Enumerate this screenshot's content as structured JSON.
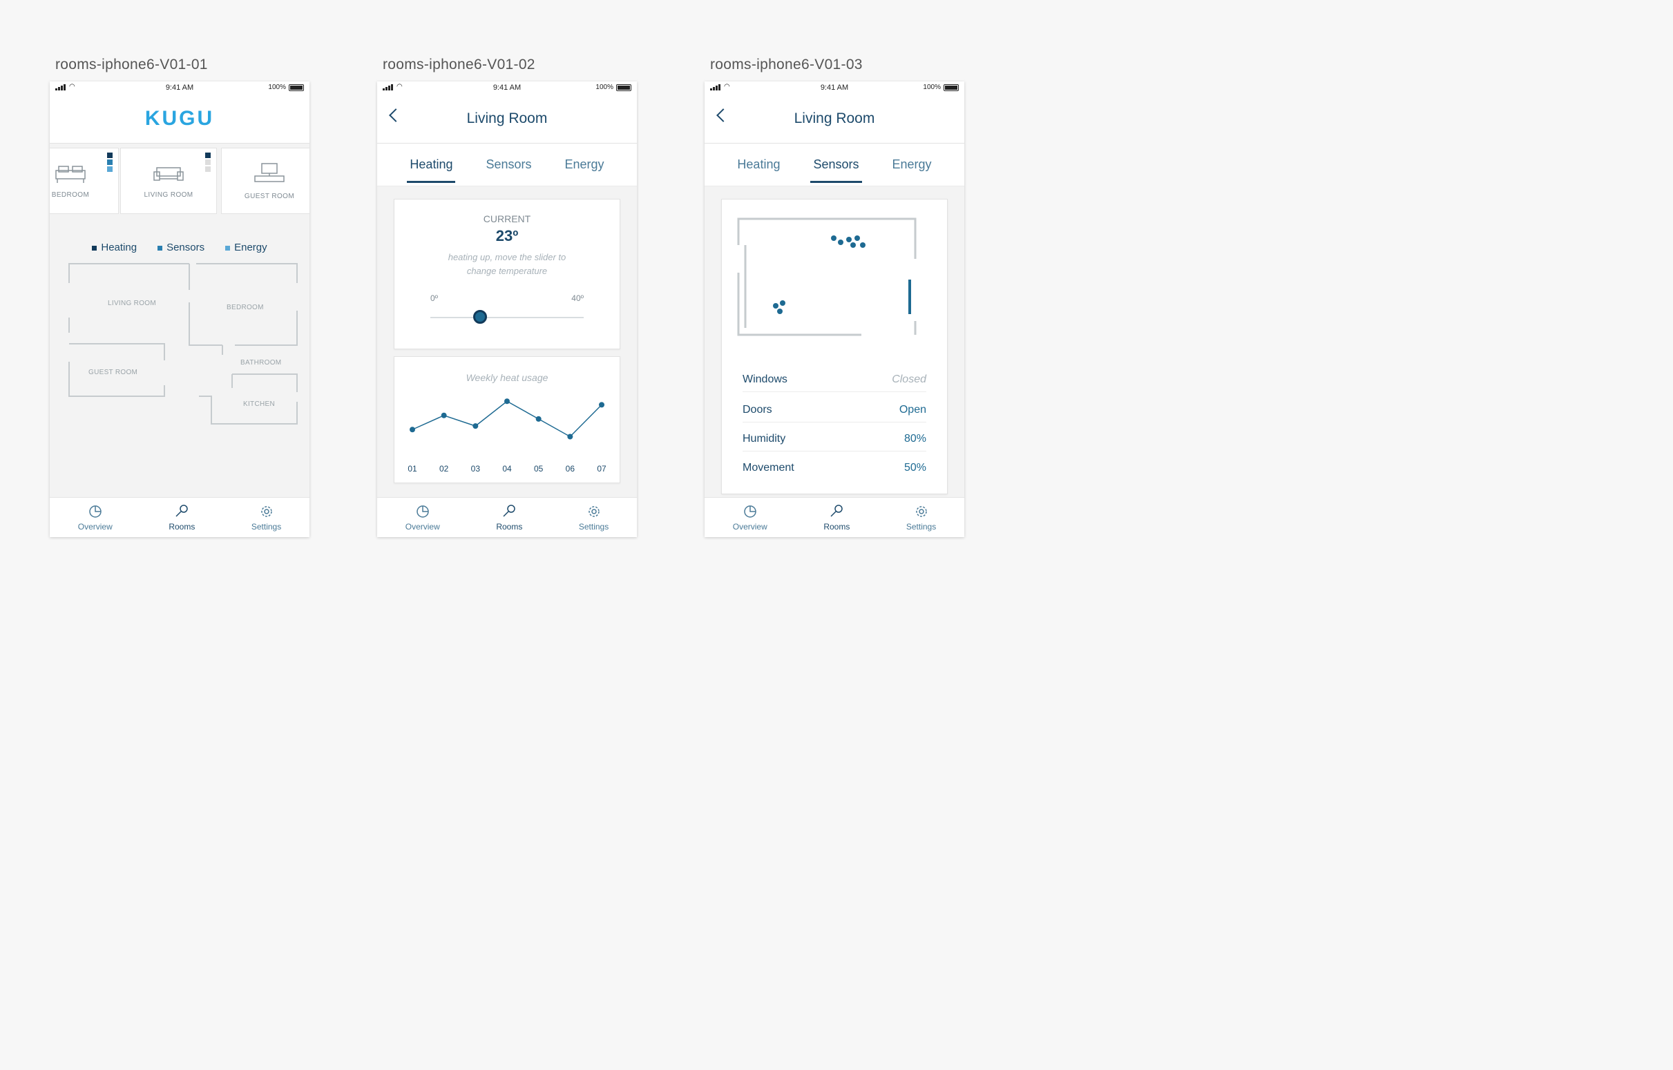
{
  "artboards": {
    "a1": "rooms-iphone6-V01-01",
    "a2": "rooms-iphone6-V01-02",
    "a3": "rooms-iphone6-V01-03"
  },
  "status": {
    "time": "9:41 AM",
    "battery": "100%"
  },
  "brand": "KUGU",
  "tabbar": {
    "overview": "Overview",
    "rooms": "Rooms",
    "settings": "Settings"
  },
  "screen1": {
    "rooms": [
      "BEDROOM",
      "LIVING ROOM",
      "GUEST ROOM"
    ],
    "legend": {
      "heating": "Heating",
      "sensors": "Sensors",
      "energy": "Energy"
    },
    "floorplan": {
      "living": "LIVING ROOM",
      "bedroom": "BEDROOM",
      "guest": "GUEST ROOM",
      "bathroom": "BATHROOM",
      "kitchen": "KITCHEN"
    }
  },
  "screen2": {
    "title": "Living Room",
    "tabs": {
      "heating": "Heating",
      "sensors": "Sensors",
      "energy": "Energy"
    },
    "current_label": "CURRENT",
    "current_value": "23º",
    "hint": "heating up, move the slider to change temperature",
    "slider_min": "0º",
    "slider_max": "40º",
    "chart_title": "Weekly heat usage"
  },
  "screen3": {
    "title": "Living Room",
    "tabs": {
      "heating": "Heating",
      "sensors": "Sensors",
      "energy": "Energy"
    },
    "rows": [
      {
        "label": "Windows",
        "value": "Closed"
      },
      {
        "label": "Doors",
        "value": "Open"
      },
      {
        "label": "Humidity",
        "value": "80%"
      },
      {
        "label": "Movement",
        "value": "50%"
      }
    ]
  },
  "chart_data": {
    "type": "line",
    "categories": [
      "01",
      "02",
      "03",
      "04",
      "05",
      "06",
      "07"
    ],
    "series": [
      {
        "values": [
          3,
          5,
          3.5,
          7,
          4.5,
          2,
          6.5
        ]
      }
    ],
    "ylim": [
      0,
      8
    ],
    "title": "Weekly heat usage"
  },
  "colors": {
    "accent": "#2aa5e0",
    "primary": "#1d4a6b",
    "point": "#1e6a92"
  }
}
